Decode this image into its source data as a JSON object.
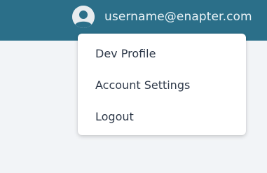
{
  "header": {
    "user_email": "username@enapter.com",
    "avatar_icon": "user-avatar-icon",
    "background_color": "#2b6f89"
  },
  "user_menu": {
    "items": [
      {
        "label": "Dev Profile"
      },
      {
        "label": "Account Settings"
      },
      {
        "label": "Logout"
      }
    ]
  }
}
